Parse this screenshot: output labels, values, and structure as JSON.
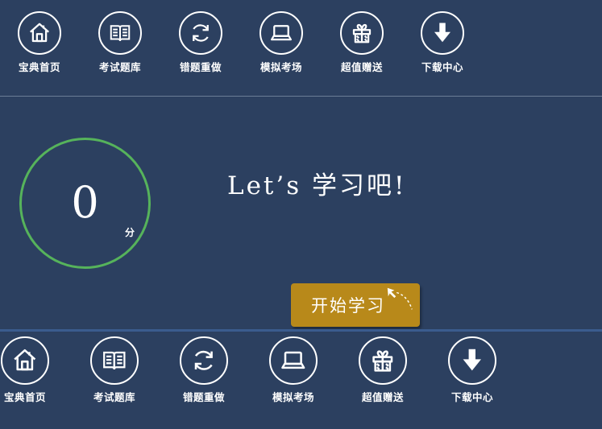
{
  "nav_top": [
    {
      "label": "宝典首页",
      "icon": "home-icon"
    },
    {
      "label": "考试题库",
      "icon": "book-icon"
    },
    {
      "label": "错题重做",
      "icon": "refresh-icon"
    },
    {
      "label": "模拟考场",
      "icon": "laptop-icon"
    },
    {
      "label": "超值赠送",
      "icon": "gift-icon"
    },
    {
      "label": "下载中心",
      "icon": "download-icon"
    }
  ],
  "nav_bottom": [
    {
      "label": "宝典首页",
      "icon": "home-icon"
    },
    {
      "label": "考试题库",
      "icon": "book-icon"
    },
    {
      "label": "错题重做",
      "icon": "refresh-icon"
    },
    {
      "label": "模拟考场",
      "icon": "laptop-icon"
    },
    {
      "label": "超值赠送",
      "icon": "gift-icon"
    },
    {
      "label": "下载中心",
      "icon": "download-icon"
    }
  ],
  "score": {
    "value": "0",
    "unit": "分"
  },
  "slogan": "Let’s 学习吧!",
  "start_button": {
    "label": "开始学习"
  },
  "colors": {
    "background": "#2c4060",
    "ring": "#56b35b",
    "button": "#b8891a"
  }
}
